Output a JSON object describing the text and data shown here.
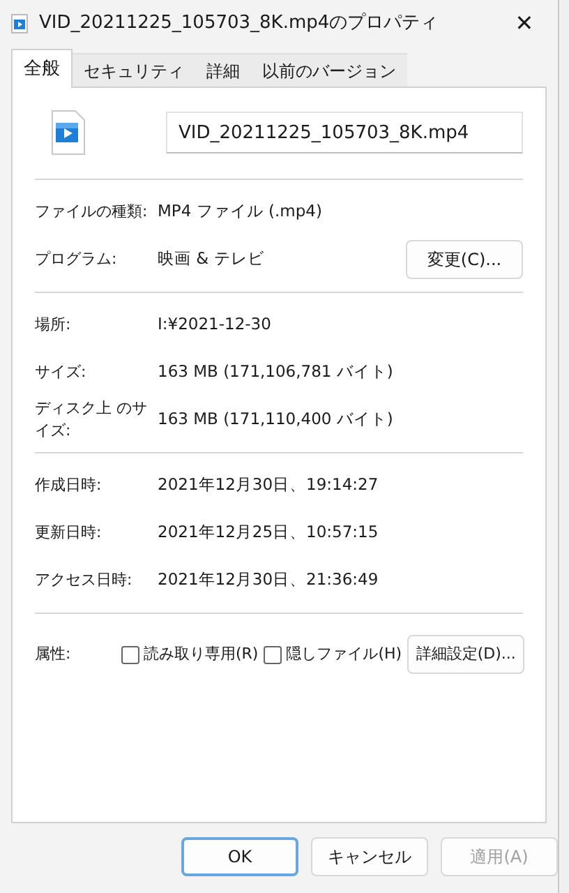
{
  "window": {
    "title": "VID_20211225_105703_8K.mp4のプロパティ",
    "close": "✕"
  },
  "tabs": [
    {
      "label": "全般",
      "selected": true
    },
    {
      "label": "セキュリティ",
      "selected": false
    },
    {
      "label": "詳細",
      "selected": false
    },
    {
      "label": "以前のバージョン",
      "selected": false
    }
  ],
  "file_name": "VID_20211225_105703_8K.mp4",
  "sections": [
    [
      {
        "label": "ファイルの種類:",
        "value": "MP4 ファイル (.mp4)"
      },
      {
        "label": "プログラム:",
        "value": "映画 & テレビ",
        "button": "変更(C)..."
      }
    ],
    [
      {
        "label": "場所:",
        "value": "I:¥2021-12-30"
      },
      {
        "label": "サイズ:",
        "value": "163 MB (171,106,781 バイト)"
      },
      {
        "label": "ディスク上 のサイズ:",
        "value": "163 MB (171,110,400 バイト)"
      }
    ],
    [
      {
        "label": "作成日時:",
        "value": "2021年12月30日、19:14:27"
      },
      {
        "label": "更新日時:",
        "value": "2021年12月25日、10:57:15"
      },
      {
        "label": "アクセス日時:",
        "value": "2021年12月30日、21:36:49"
      }
    ]
  ],
  "attributes": {
    "label": "属性:",
    "checkboxes": [
      {
        "label": "読み取り専用(R)",
        "checked": false
      },
      {
        "label": "隠しファイル(H)",
        "checked": false
      }
    ],
    "button": "詳細設定(D)..."
  },
  "buttons": [
    {
      "label": "OK",
      "default": true,
      "disabled": false
    },
    {
      "label": "キャンセル",
      "default": false,
      "disabled": false
    },
    {
      "label": "適用(A)",
      "default": false,
      "disabled": true
    }
  ]
}
